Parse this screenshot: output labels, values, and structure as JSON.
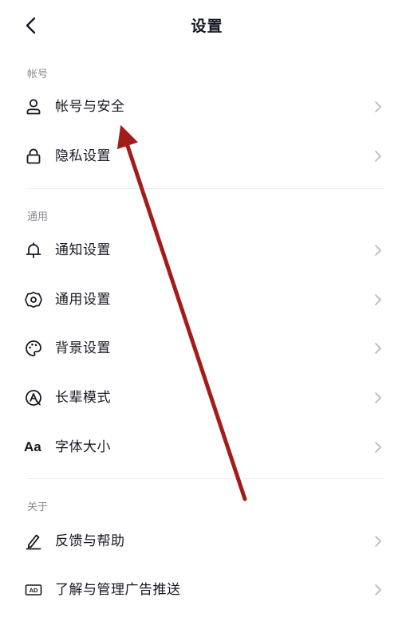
{
  "header": {
    "title": "设置"
  },
  "sections": [
    {
      "label": "帐号",
      "items": [
        {
          "label": "帐号与安全",
          "icon": "user-icon"
        },
        {
          "label": "隐私设置",
          "icon": "lock-icon"
        }
      ]
    },
    {
      "label": "通用",
      "items": [
        {
          "label": "通知设置",
          "icon": "bell-icon"
        },
        {
          "label": "通用设置",
          "icon": "gear-icon"
        },
        {
          "label": "背景设置",
          "icon": "palette-icon"
        },
        {
          "label": "长辈模式",
          "icon": "elder-mode-icon"
        },
        {
          "label": "字体大小",
          "icon": "font-size-icon",
          "icon_text": "Aa"
        }
      ]
    },
    {
      "label": "关于",
      "items": [
        {
          "label": "反馈与帮助",
          "icon": "pen-icon"
        },
        {
          "label": "了解与管理广告推送",
          "icon": "ad-icon",
          "icon_text": "AD"
        }
      ]
    }
  ],
  "colors": {
    "text": "#161823",
    "muted": "#8a8b91",
    "chevron": "#b7b8bc",
    "divider": "#ececee",
    "annotation_arrow": "#a31c1c"
  }
}
